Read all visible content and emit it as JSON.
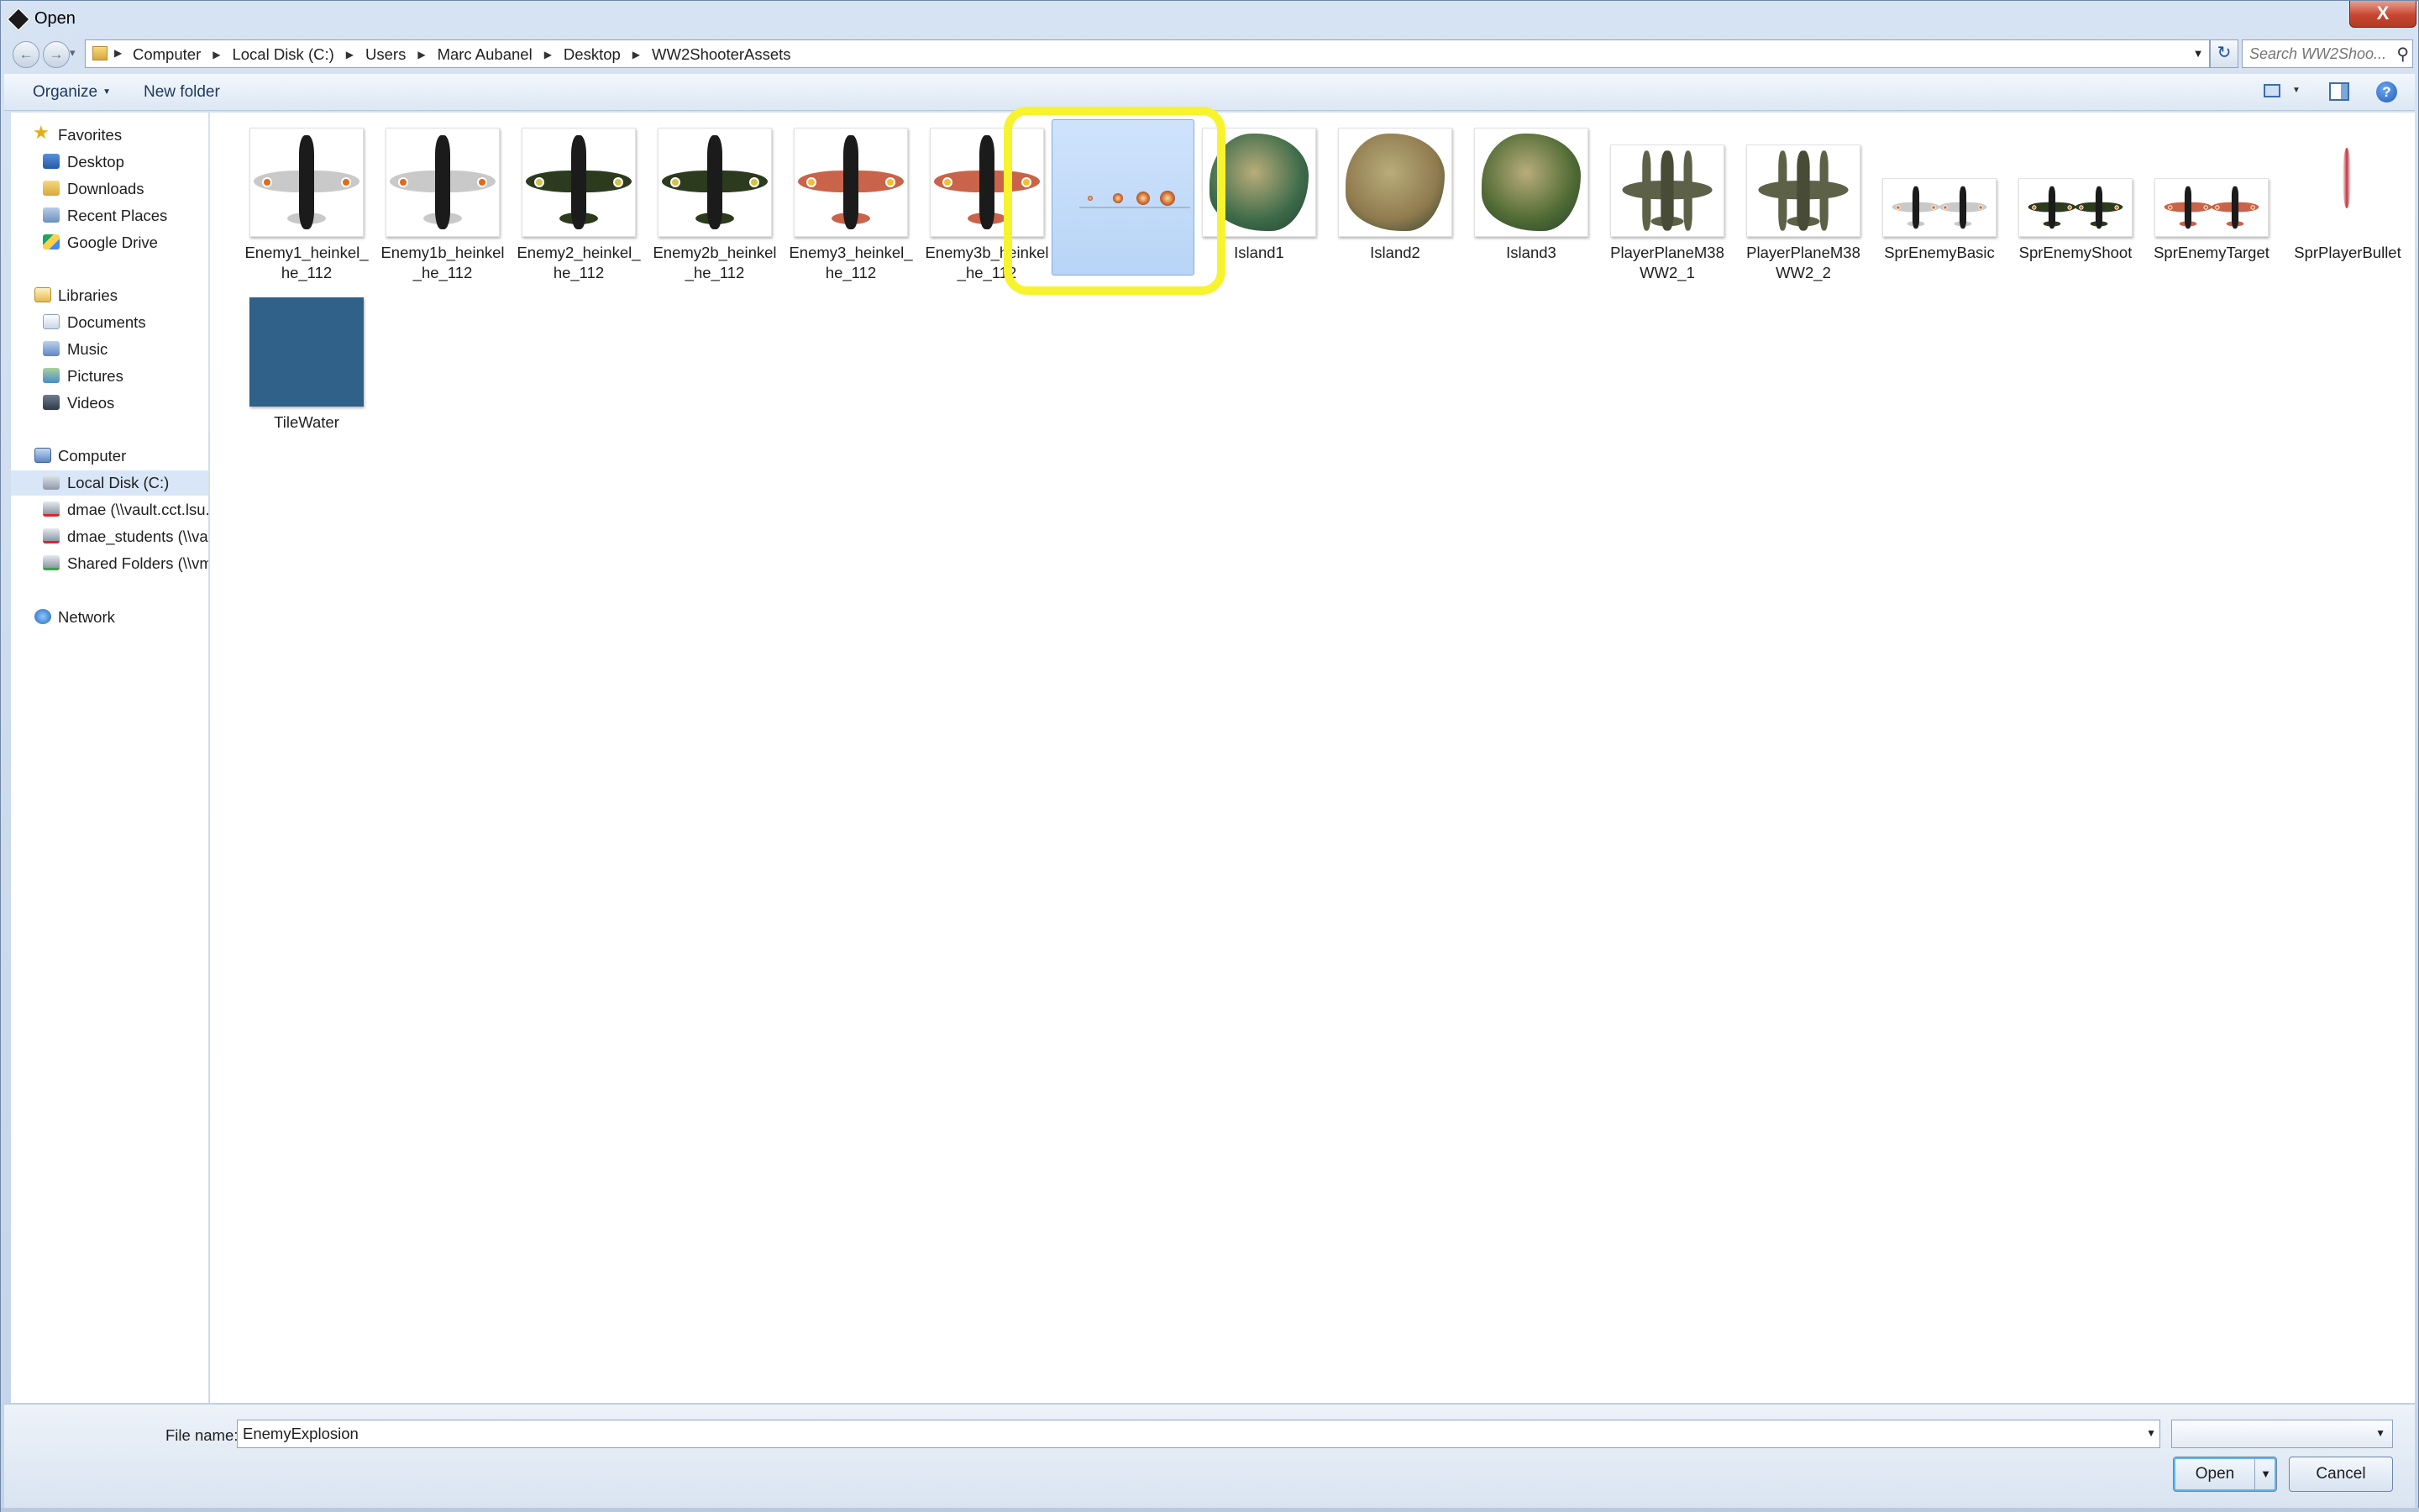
{
  "window": {
    "title": "Open",
    "close_glyph": "X"
  },
  "address": {
    "crumbs": [
      "Computer",
      "Local Disk (C:)",
      "Users",
      "Marc Aubanel",
      "Desktop",
      "WW2ShooterAssets"
    ],
    "search_placeholder": "Search WW2Shoo..."
  },
  "toolbar": {
    "organize": "Organize",
    "new_folder": "New folder"
  },
  "nav": {
    "favorites": {
      "header": "Favorites",
      "items": [
        "Desktop",
        "Downloads",
        "Recent Places",
        "Google Drive"
      ]
    },
    "libraries": {
      "header": "Libraries",
      "items": [
        "Documents",
        "Music",
        "Pictures",
        "Videos"
      ]
    },
    "computer": {
      "header": "Computer",
      "items": [
        "Local Disk (C:)",
        "dmae (\\\\vault.cct.lsu.e",
        "dmae_students (\\\\vau",
        "Shared Folders (\\\\vm"
      ]
    },
    "network": {
      "header": "Network"
    }
  },
  "files": [
    {
      "name": "Enemy1_heinkel_he_112",
      "kind": "plane",
      "color": "#c9c9c9",
      "mark": "#e06a1c"
    },
    {
      "name": "Enemy1b_heinkel_he_112",
      "kind": "plane",
      "color": "#c9c9c9",
      "mark": "#e06a1c"
    },
    {
      "name": "Enemy2_heinkel_he_112",
      "kind": "plane",
      "color": "#2c3a1e",
      "mark": "#d4c24a"
    },
    {
      "name": "Enemy2b_heinkel_he_112",
      "kind": "plane",
      "color": "#2c3a1e",
      "mark": "#d4c24a"
    },
    {
      "name": "Enemy3_heinkel_he_112",
      "kind": "plane",
      "color": "#c9634a",
      "mark": "#f0c030"
    },
    {
      "name": "Enemy3b_heinkel_he_112",
      "kind": "plane",
      "color": "#c9634a",
      "mark": "#f0c030"
    },
    {
      "name": "EnemyExplosion",
      "kind": "explosion",
      "selected": true
    },
    {
      "name": "Island1",
      "kind": "island",
      "color": "#3d6b4a"
    },
    {
      "name": "Island2",
      "kind": "island",
      "color": "#8f7a4e"
    },
    {
      "name": "Island3",
      "kind": "island",
      "color": "#4f6a34"
    },
    {
      "name": "PlayerPlaneM38WW2_1",
      "kind": "p38",
      "color": "#5d6147"
    },
    {
      "name": "PlayerPlaneM38WW2_2",
      "kind": "p38",
      "color": "#5d6147"
    },
    {
      "name": "SprEnemyBasic",
      "kind": "sprite",
      "color": "#c9c9c9"
    },
    {
      "name": "SprEnemyShoot",
      "kind": "sprite",
      "color": "#2c3a1e"
    },
    {
      "name": "SprEnemyTarget",
      "kind": "sprite",
      "color": "#c9634a"
    },
    {
      "name": "SprPlayerBullet",
      "kind": "bullet"
    },
    {
      "name": "TileWater",
      "kind": "water"
    }
  ],
  "file_labels": [
    [
      "Enemy1_heinkel_",
      "he_112"
    ],
    [
      "Enemy1b_heinkel",
      "_he_112"
    ],
    [
      "Enemy2_heinkel_",
      "he_112"
    ],
    [
      "Enemy2b_heinkel",
      "_he_112"
    ],
    [
      "Enemy3_heinkel_",
      "he_112"
    ],
    [
      "Enemy3b_heinkel",
      "_he_112"
    ],
    [
      "EnemyExplosion"
    ],
    [
      "Island1"
    ],
    [
      "Island2"
    ],
    [
      "Island3"
    ],
    [
      "PlayerPlaneM38",
      "WW2_1"
    ],
    [
      "PlayerPlaneM38",
      "WW2_2"
    ],
    [
      "SprEnemyBasic"
    ],
    [
      "SprEnemyShoot"
    ],
    [
      "SprEnemyTarget"
    ],
    [
      "SprPlayerBullet"
    ],
    [
      "TileWater"
    ]
  ],
  "footer": {
    "file_name_label": "File name:",
    "file_name_value": "EnemyExplosion",
    "open_label": "Open",
    "cancel_label": "Cancel"
  },
  "colors": {
    "highlight": "#f7f32f",
    "selection": "#cfe3fc"
  }
}
